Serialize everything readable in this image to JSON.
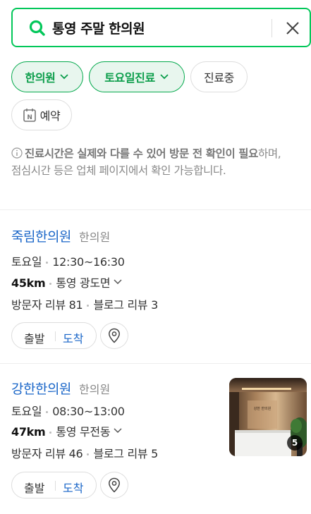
{
  "search": {
    "query": "통영 주말 한의원",
    "clear_icon": "close-icon"
  },
  "filters": [
    {
      "label": "한의원",
      "active": true,
      "dropdown": true
    },
    {
      "label": "토요일진료",
      "active": true,
      "dropdown": true
    },
    {
      "label": "진료중",
      "active": false
    },
    {
      "label": "예약",
      "active": false,
      "icon": "naver-booking-icon"
    }
  ],
  "notice": {
    "bold": "진료시간은 실제와 다를 수 있어 방문 전 확인이 필요",
    "rest": "하며, 점심시간 등은 업체 페이지에서 확인 가능합니다."
  },
  "places": [
    {
      "name": "죽림한의원",
      "category": "한의원",
      "day": "토요일",
      "hours": "12:30~16:30",
      "distance": "45km",
      "address": "통영 광도면",
      "visitor_reviews": "방문자 리뷰 81",
      "blog_reviews": "블로그 리뷰 3",
      "depart": "출발",
      "arrive": "도착"
    },
    {
      "name": "강한한의원",
      "category": "한의원",
      "day": "토요일",
      "hours": "08:30~13:00",
      "distance": "47km",
      "address": "통영 무전동",
      "visitor_reviews": "방문자 리뷰 46",
      "blog_reviews": "블로그 리뷰 5",
      "depart": "출발",
      "arrive": "도착",
      "photo_count": "5"
    }
  ],
  "colors": {
    "brand_green": "#03c75a",
    "link_blue": "#1a66c8"
  }
}
